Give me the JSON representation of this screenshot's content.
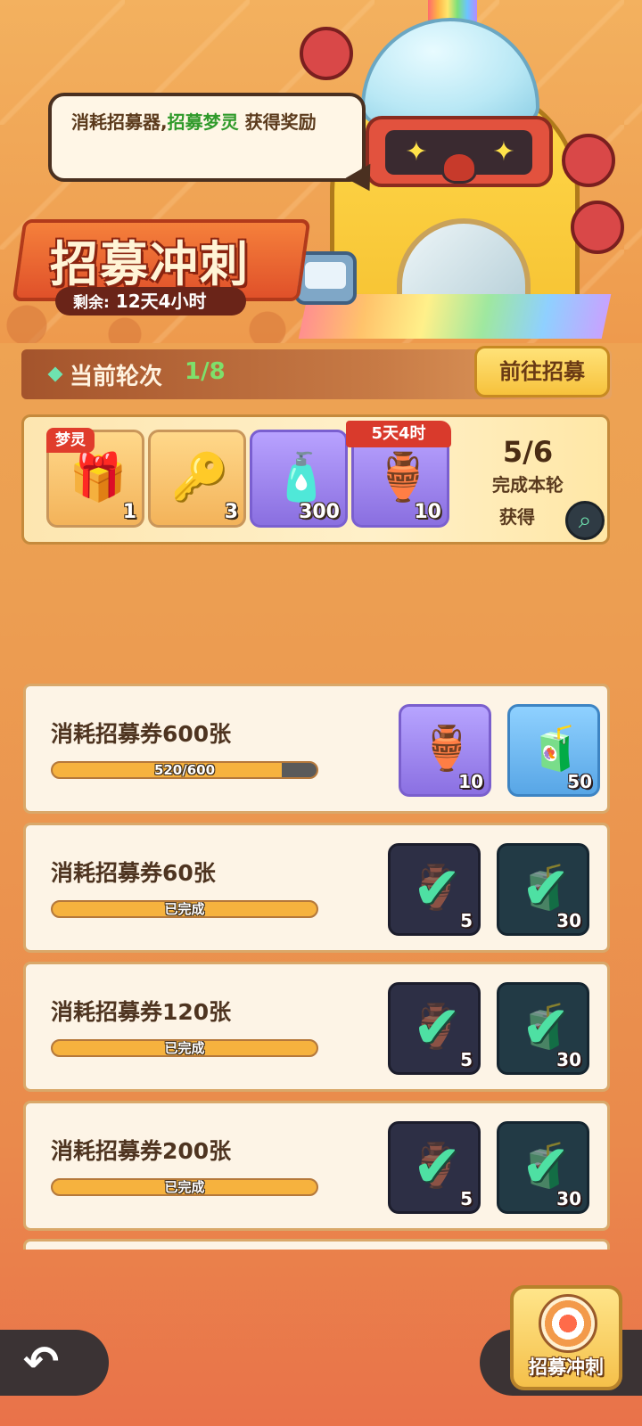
{
  "banner": {
    "speech_prefix": "消耗招募器,",
    "speech_highlight": "招募梦灵",
    "speech_suffix": " 获得奖励",
    "event_title": "招募冲刺",
    "remaining_label": "剩余:",
    "remaining_value": "12天4小时"
  },
  "round": {
    "label": "当前轮次",
    "value": "1/8",
    "go_button": "前往招募"
  },
  "round_rewards": {
    "items": [
      {
        "icon": "mystery-chest-icon",
        "glyph": "🎁",
        "quantity": "1",
        "tag": "梦灵"
      },
      {
        "icon": "star-key-icon",
        "glyph": "🔑",
        "quantity": "3"
      },
      {
        "icon": "rainbow-bottle-icon",
        "glyph": "🧴",
        "quantity": "300"
      },
      {
        "icon": "spirit-pedestal-icon",
        "glyph": "🏺",
        "quantity": "10",
        "tag": "5天4时"
      }
    ],
    "progress": "5/6",
    "progress_desc": "完成本轮",
    "get_label": "获得"
  },
  "tasks": [
    {
      "title": "消耗招募券600张",
      "progress_text": "520/600",
      "progress_fraction": 0.867,
      "completed": false,
      "rewards": [
        {
          "icon": "spirit-pedestal-icon",
          "glyph": "🏺",
          "quantity": "10"
        },
        {
          "icon": "mystery-bottle-icon",
          "glyph": "🧃",
          "quantity": "50"
        }
      ]
    },
    {
      "title": "消耗招募券60张",
      "progress_text": "已完成",
      "progress_fraction": 1.0,
      "completed": true,
      "rewards": [
        {
          "icon": "spirit-pedestal-icon",
          "glyph": "🏺",
          "quantity": "5"
        },
        {
          "icon": "bottle-icon",
          "glyph": "🧃",
          "quantity": "30"
        }
      ]
    },
    {
      "title": "消耗招募券120张",
      "progress_text": "已完成",
      "progress_fraction": 1.0,
      "completed": true,
      "rewards": [
        {
          "icon": "spirit-pedestal-icon",
          "glyph": "🏺",
          "quantity": "5"
        },
        {
          "icon": "bottle-icon",
          "glyph": "🧃",
          "quantity": "30"
        }
      ]
    },
    {
      "title": "消耗招募券200张",
      "progress_text": "已完成",
      "progress_fraction": 1.0,
      "completed": true,
      "rewards": [
        {
          "icon": "spirit-pedestal-icon",
          "glyph": "🏺",
          "quantity": "5"
        },
        {
          "icon": "bottle-icon",
          "glyph": "🧃",
          "quantity": "30"
        }
      ]
    }
  ],
  "bottom": {
    "back_icon": "back-arrow-icon",
    "sprint_label": "招募冲刺"
  },
  "colors": {
    "highlight_green": "#2f9a2a",
    "round_value_green": "#7ee06b",
    "progress_fill": "#f6b23e",
    "check_green": "#4ee0a3",
    "tag_red": "#e03c2c"
  }
}
